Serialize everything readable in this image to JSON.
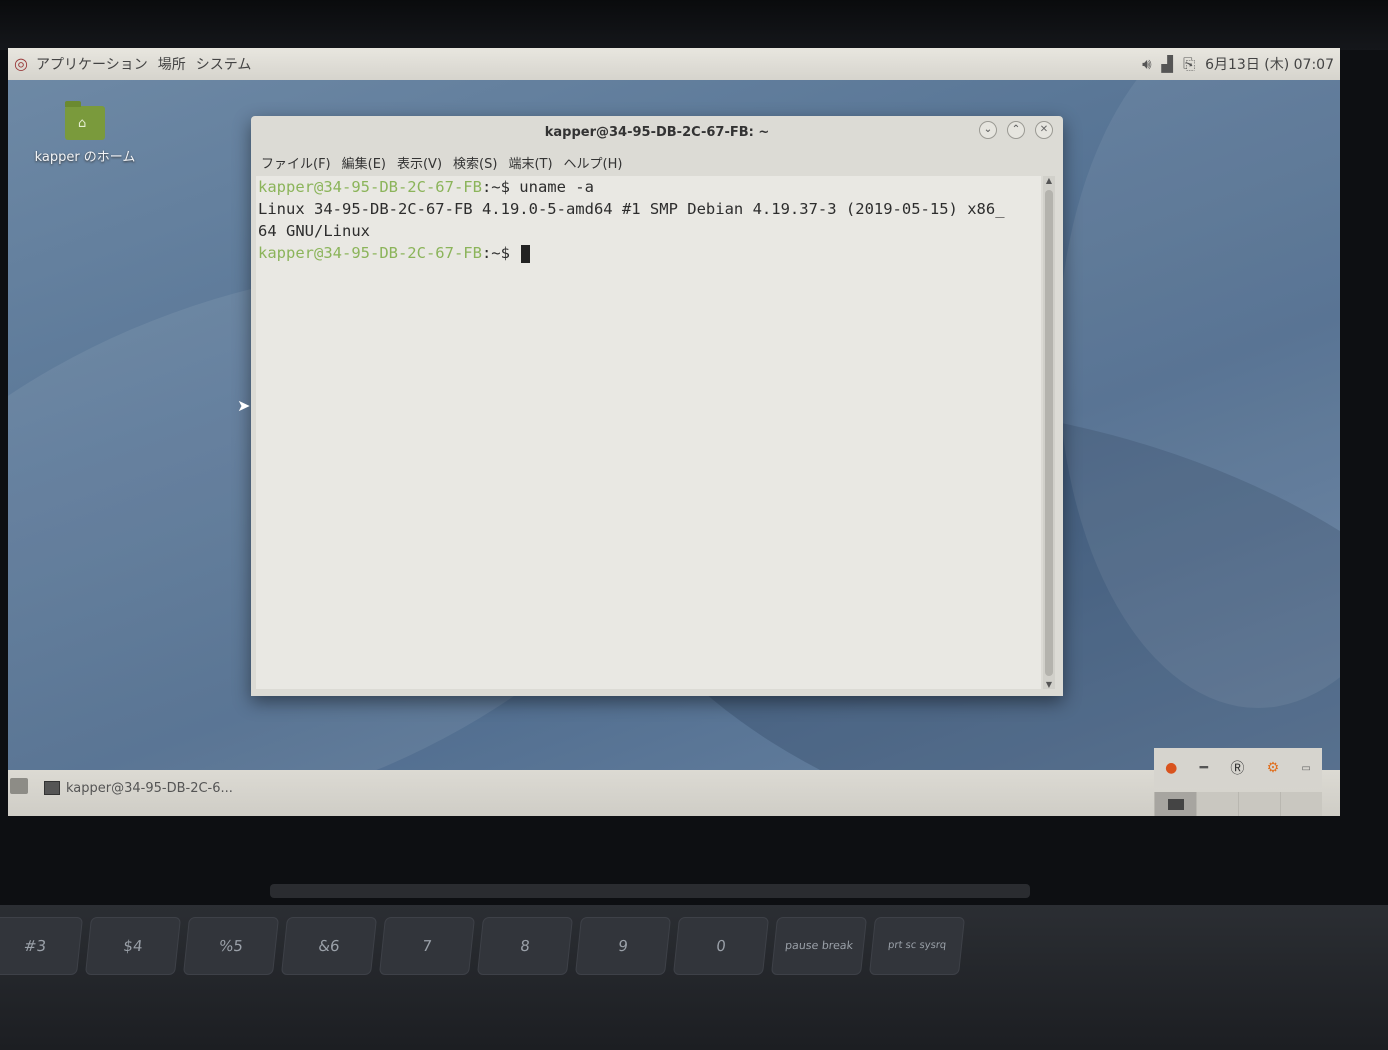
{
  "top_panel": {
    "menus": [
      "アプリケーション",
      "場所",
      "システム"
    ],
    "clock": "6月13日 (木) 07:07"
  },
  "desktop": {
    "home_icon_label": "kapper のホーム"
  },
  "terminal": {
    "title": "kapper@34-95-DB-2C-67-FB: ~",
    "menus": [
      "ファイル(F)",
      "編集(E)",
      "表示(V)",
      "検索(S)",
      "端末(T)",
      "ヘルプ(H)"
    ],
    "prompt": "kapper@34-95-DB-2C-67-FB",
    "prompt_suffix": ":~$",
    "command": " uname -a",
    "output_line1": "Linux 34-95-DB-2C-67-FB 4.19.0-5-amd64 #1 SMP Debian 4.19.37-3 (2019-05-15) x86_",
    "output_line2": "64 GNU/Linux",
    "prompt2": "kapper@34-95-DB-2C-67-FB",
    "prompt2_suffix": ":~$"
  },
  "taskbar": {
    "task_label": "kapper@34-95-DB-2C-6..."
  },
  "keyboard": {
    "keys": [
      "#3",
      "$4",
      "%5",
      "&6",
      "7",
      "8",
      "9",
      "0",
      "pause break",
      "prt sc sysrq"
    ]
  },
  "colors": {
    "prompt": "#8bb45a",
    "terminal_bg": "#e9e8e3",
    "panel_bg": "#d6d4cd"
  }
}
